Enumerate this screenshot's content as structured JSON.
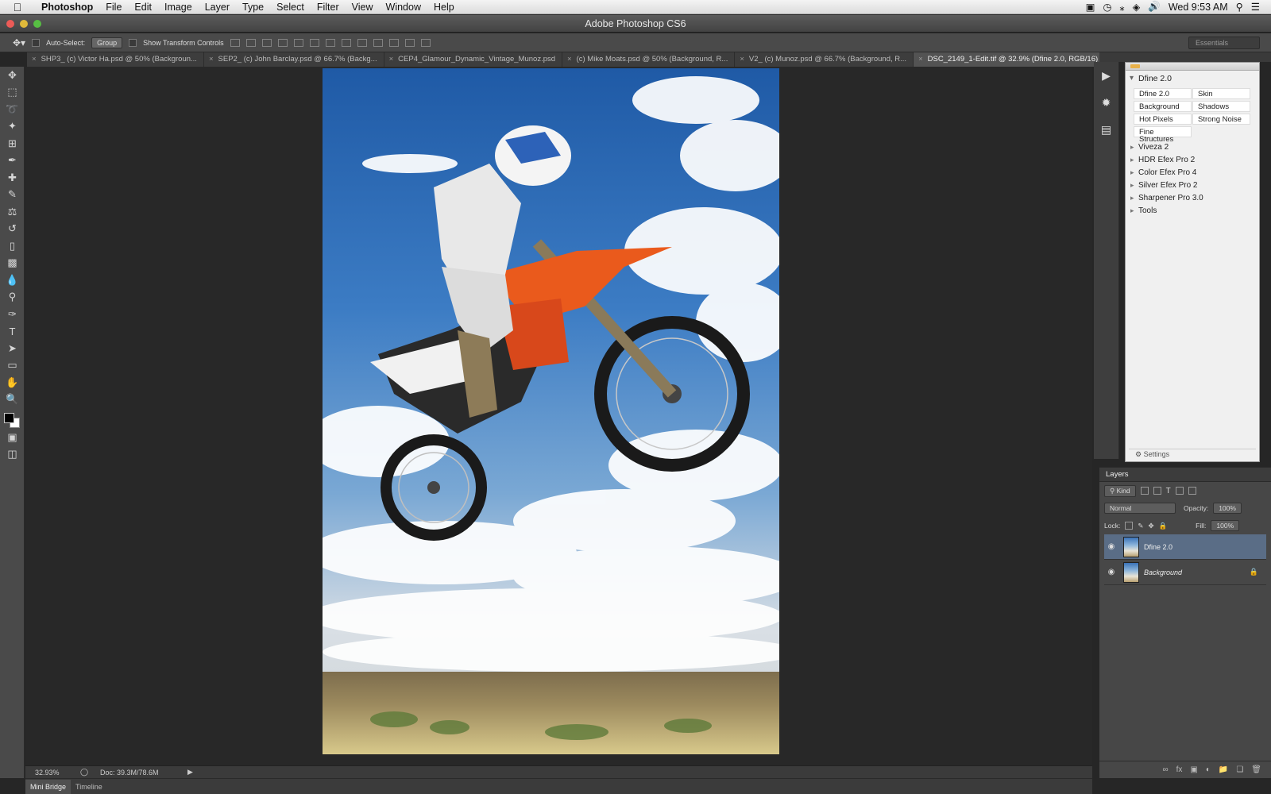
{
  "menubar": {
    "app": "Photoshop",
    "items": [
      "File",
      "Edit",
      "Image",
      "Layer",
      "Type",
      "Select",
      "Filter",
      "View",
      "Window",
      "Help"
    ],
    "clock": "Wed 9:53 AM"
  },
  "window": {
    "title": "Adobe Photoshop CS6"
  },
  "options": {
    "auto_select_label": "Auto-Select:",
    "auto_select_value": "Group",
    "transform_label": "Show Transform Controls",
    "workspace": "Essentials"
  },
  "tabs": [
    {
      "label": "SHP3_ (c) Victor Ha.psd @ 50% (Backgroun..."
    },
    {
      "label": "SEP2_ (c) John Barclay.psd @ 66.7% (Backg..."
    },
    {
      "label": "CEP4_Glamour_Dynamic_Vintage_Munoz.psd"
    },
    {
      "label": "(c) Mike Moats.psd @ 50% (Background, R..."
    },
    {
      "label": "V2_ (c) Munoz.psd @ 66.7% (Background, R..."
    },
    {
      "label": "DSC_2149_1-Edit.tif @ 32.9% (Dfine 2.0, RGB/16) *"
    }
  ],
  "status": {
    "zoom": "32.93%",
    "doc": "Doc: 39.3M/78.6M"
  },
  "bottom_tabs": [
    "Mini Bridge",
    "Timeline"
  ],
  "plugin": {
    "header": "Dfine 2.0",
    "presets": [
      "Dfine 2.0",
      "Skin",
      "Background",
      "Shadows",
      "Hot Pixels",
      "Strong Noise",
      "Fine Structures"
    ],
    "items": [
      "Viveza 2",
      "HDR Efex Pro 2",
      "Color Efex Pro 4",
      "Silver Efex Pro 2",
      "Sharpener Pro 3.0",
      "Tools"
    ],
    "settings": "Settings"
  },
  "layers": {
    "title": "Layers",
    "kind": "Kind",
    "blend": "Normal",
    "opacity_label": "Opacity:",
    "opacity": "100%",
    "lock_label": "Lock:",
    "fill_label": "Fill:",
    "fill": "100%",
    "items": [
      {
        "name": "Dfine 2.0"
      },
      {
        "name": "Background"
      }
    ]
  }
}
